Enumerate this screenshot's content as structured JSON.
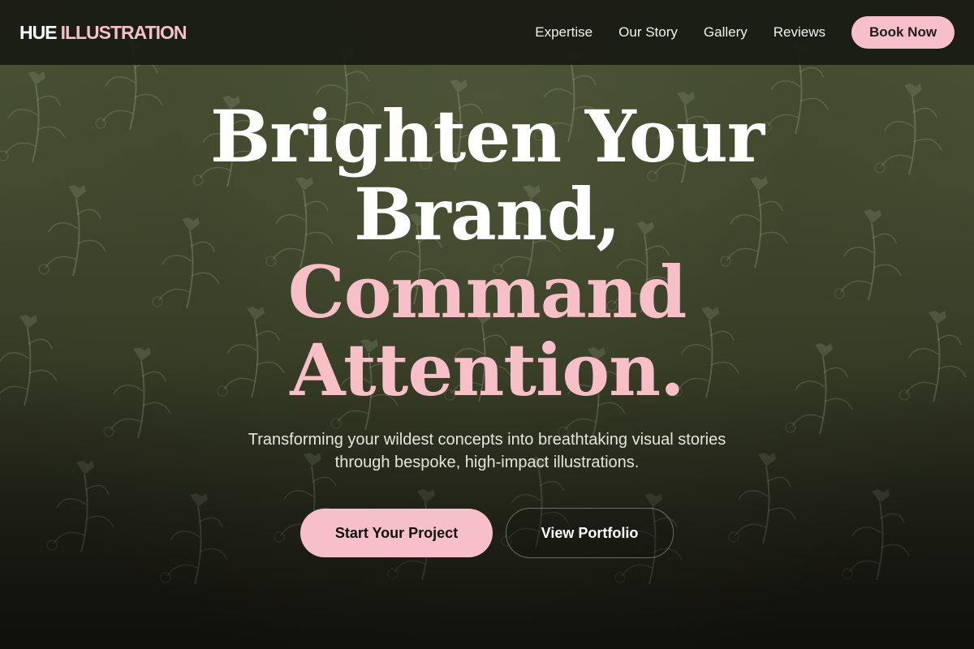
{
  "brand": {
    "part1": "HUE",
    "part2": "ILLUSTRATION"
  },
  "nav": {
    "links": [
      "Expertise",
      "Our Story",
      "Gallery",
      "Reviews"
    ],
    "cta": "Book Now"
  },
  "hero": {
    "line1": "Brighten Your",
    "line2": "Brand,",
    "line3": "Command",
    "line4": "Attention.",
    "subtitle": "Transforming your wildest concepts into breathtaking visual stories through bespoke, high-impact illustrations.",
    "primary_cta": "Start Your Project",
    "secondary_cta": "View Portfolio"
  },
  "colors": {
    "accent_pink": "#f7bfc8",
    "nav_bg": "#181a12",
    "hero_bg": "#434a30"
  },
  "background_pattern": "botanical-leaf-pattern"
}
